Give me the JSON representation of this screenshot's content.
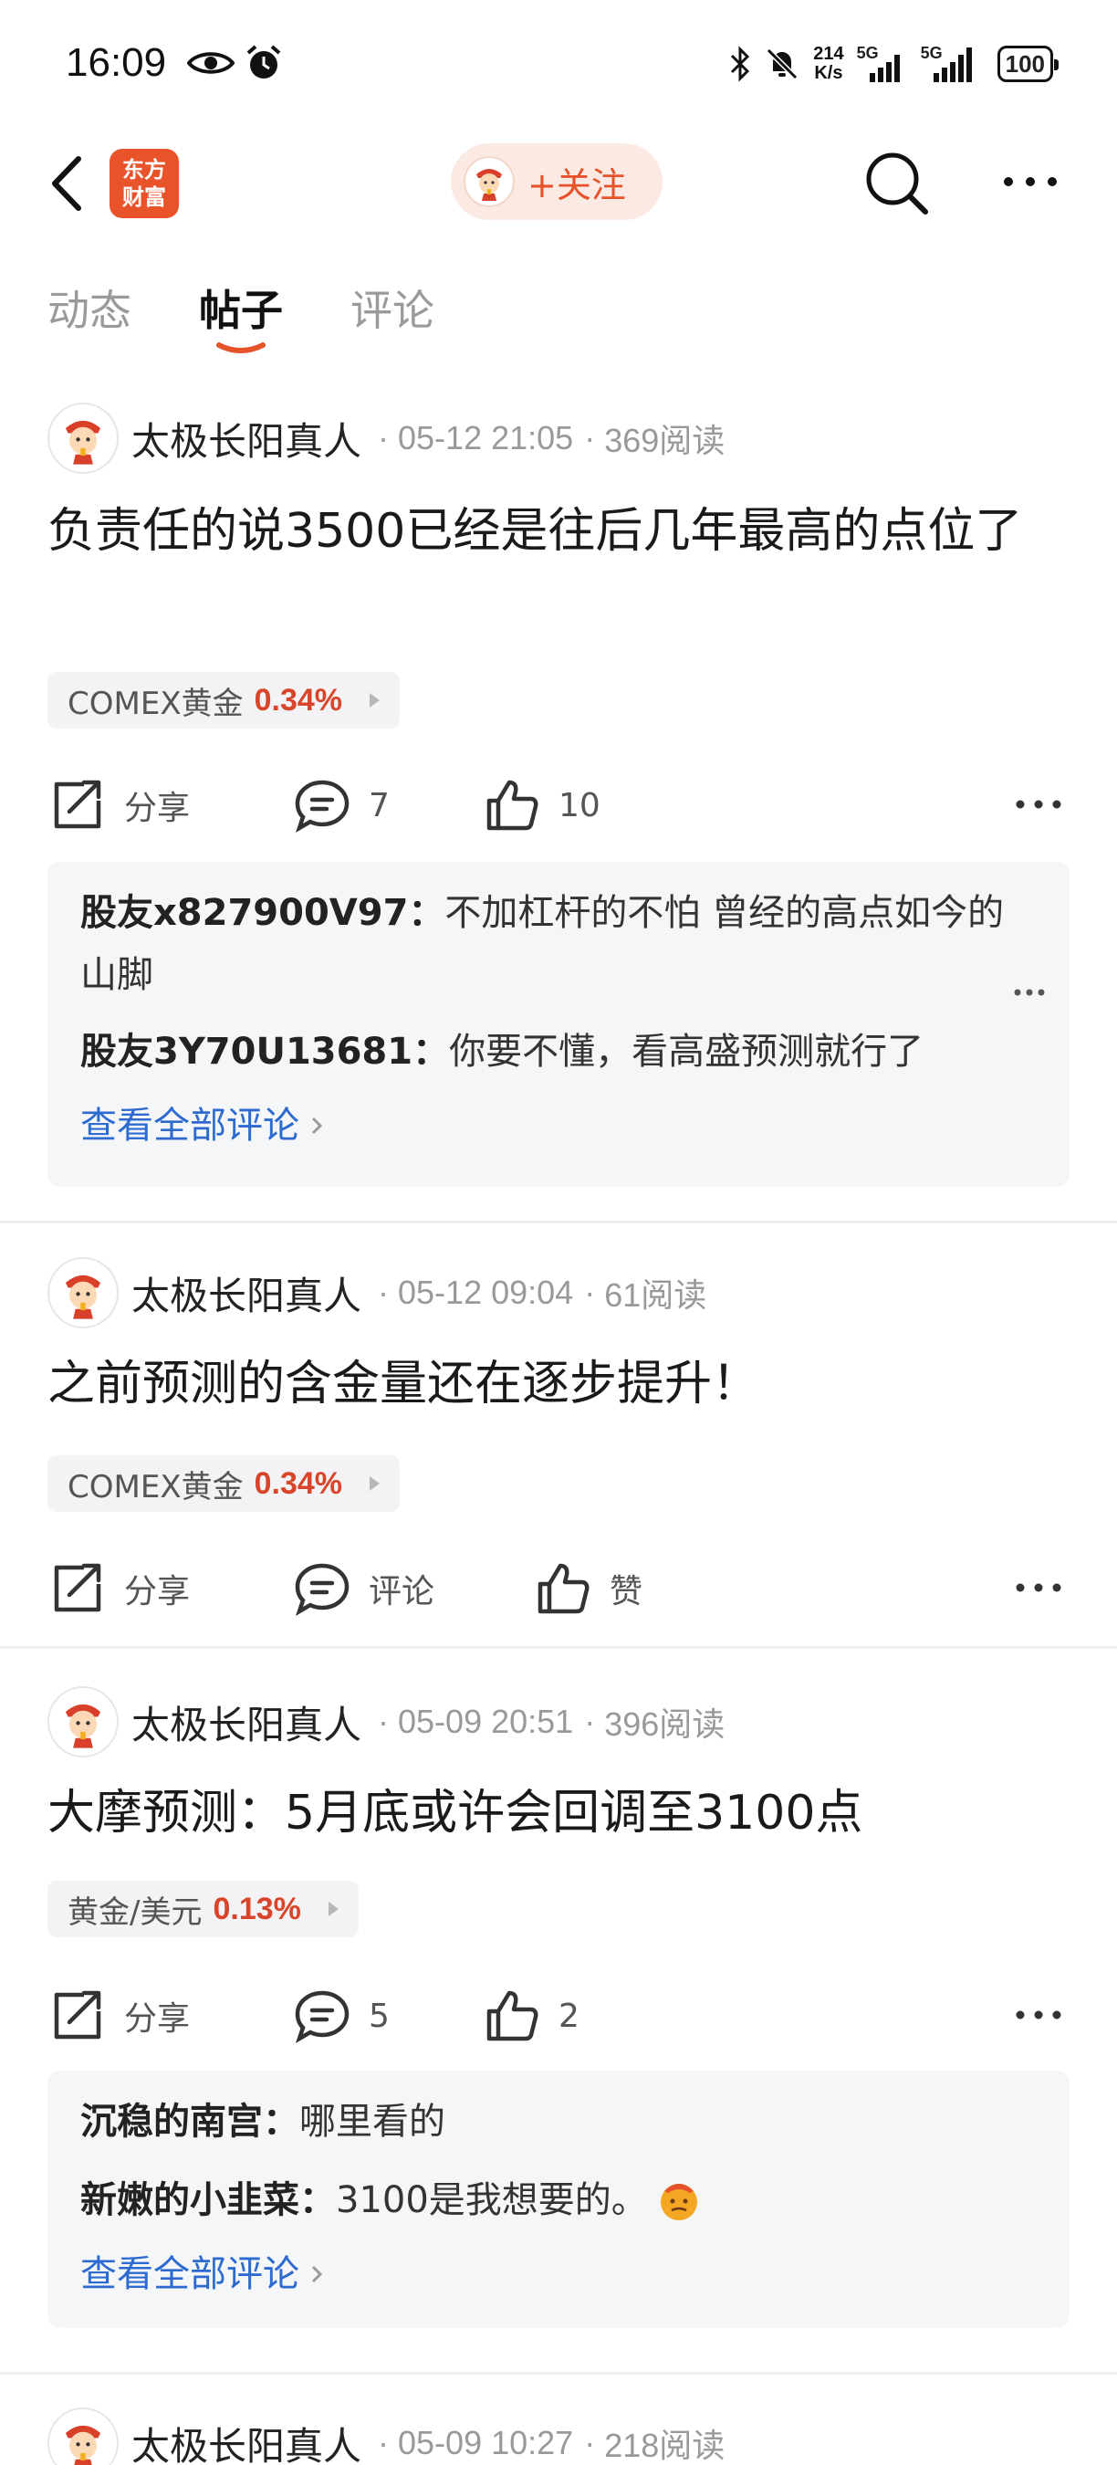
{
  "status_bar": {
    "time": "16:09",
    "speed_value": "214",
    "speed_unit": "K/s",
    "network_1": "5G",
    "network_2": "5G",
    "battery": "100",
    "icons": [
      "eye-icon",
      "alarm-icon",
      "bluetooth-icon",
      "mute-bell-icon",
      "signal-icon",
      "battery-icon"
    ]
  },
  "header": {
    "logo_text_1": "东方",
    "logo_text_2": "财富",
    "follow_label": "+关注",
    "icons": [
      "back-icon",
      "search-icon",
      "more-icon"
    ]
  },
  "tabs": [
    {
      "label": "动态",
      "active": false
    },
    {
      "label": "帖子",
      "active": true
    },
    {
      "label": "评论",
      "active": false
    }
  ],
  "posts": [
    {
      "author": "太极长阳真人",
      "date": "05-12 21:05",
      "reads": "369阅读",
      "title": "负责任的说3500已经是往后几年最高的点位了",
      "stock_name": "COMEX黄金",
      "stock_change": "0.34%",
      "share_label": "分享",
      "comment_count": "7",
      "like_count": "10",
      "comments": [
        {
          "user": "股友x827900V97",
          "sep": "：",
          "text": "不加杠杆的不怕 曾经的高点如今的山脚"
        },
        {
          "user": "股友3Y70U13681",
          "sep": "：",
          "text": "你要不懂，看高盛预测就行了"
        }
      ],
      "view_all": "查看全部评论"
    },
    {
      "author": "太极长阳真人",
      "date": "05-12 09:04",
      "reads": "61阅读",
      "title": "之前预测的含金量还在逐步提升！",
      "stock_name": "COMEX黄金",
      "stock_change": "0.34%",
      "share_label": "分享",
      "comment_label": "评论",
      "like_label": "赞"
    },
    {
      "author": "太极长阳真人",
      "date": "05-09 20:51",
      "reads": "396阅读",
      "title": "大摩预测：5月底或许会回调至3100点",
      "stock_name": "黄金/美元",
      "stock_change": "0.13%",
      "share_label": "分享",
      "comment_count": "5",
      "like_count": "2",
      "comments": [
        {
          "user": "沉稳的南宫",
          "sep": "：",
          "text": "哪里看的"
        },
        {
          "user": "新嫩的小韭菜",
          "sep": "：",
          "text": "3100是我想要的。"
        }
      ],
      "view_all": "查看全部评论"
    },
    {
      "author": "太极长阳真人",
      "date": "05-09 10:27",
      "reads": "218阅读"
    }
  ],
  "colors": {
    "accent": "#e7522a",
    "link": "#2d6bd1",
    "up": "#d9452a"
  }
}
